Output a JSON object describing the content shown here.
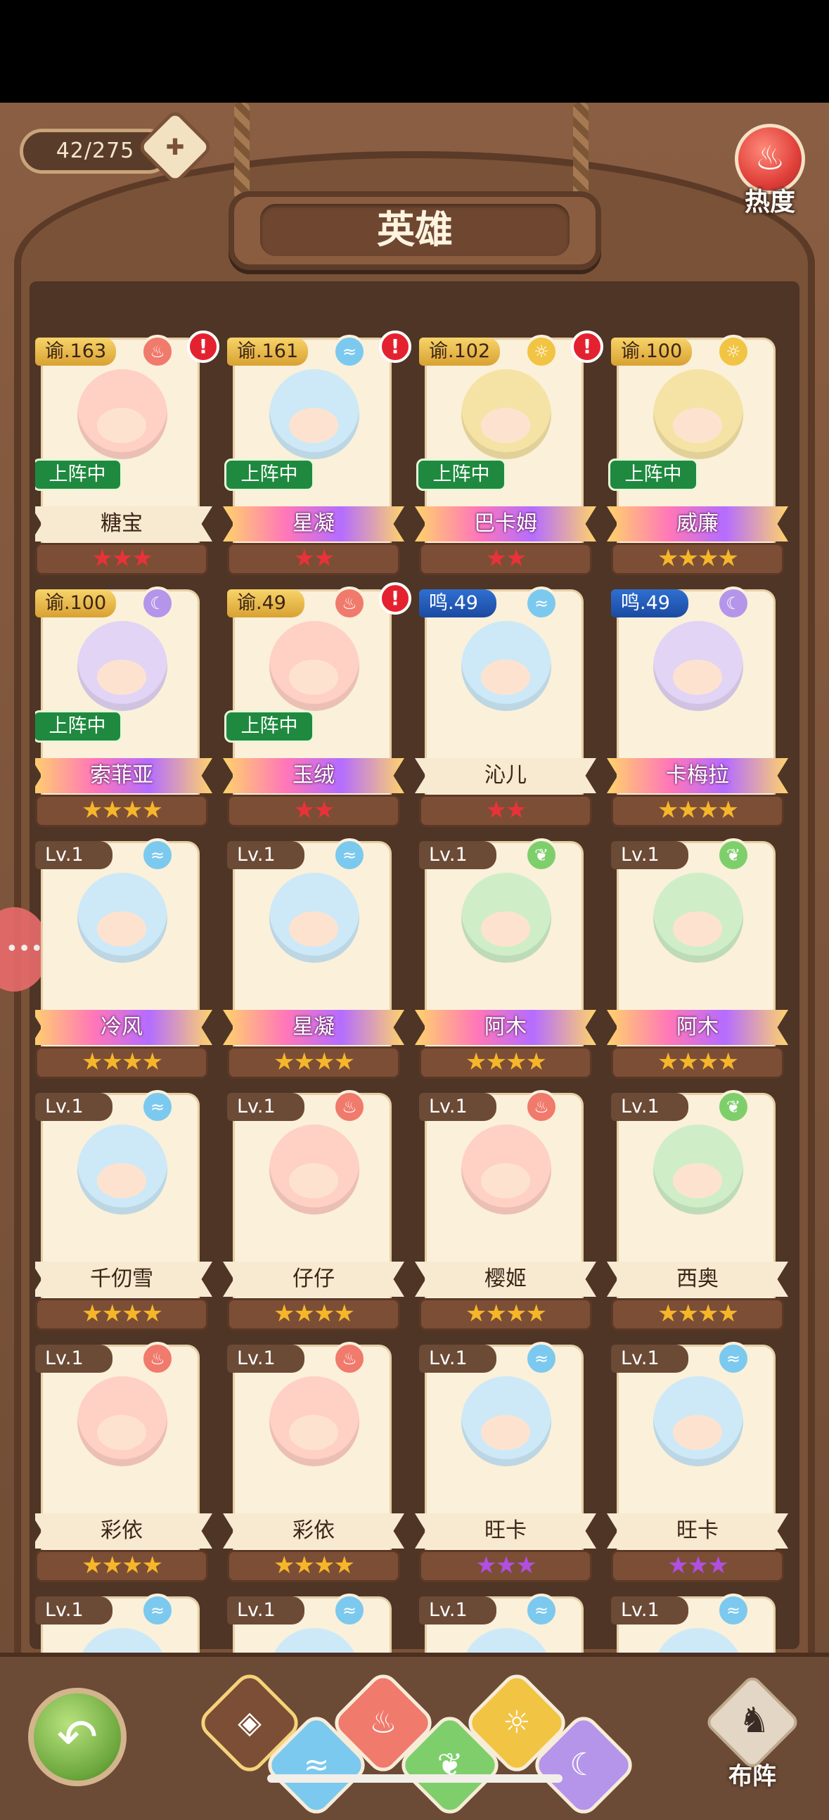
{
  "header": {
    "counter": "42/275",
    "title": "英雄",
    "heat_label": "热度"
  },
  "colors": {
    "fire": "#f07a6c",
    "water": "#7cc9ef",
    "light": "#f1c444",
    "dark": "#b595ea",
    "wood": "#7ecf6b"
  },
  "heroes": [
    {
      "level": "谕.163",
      "element": "fire",
      "name": "糖宝",
      "stars": "★★★",
      "alert": true,
      "on_team": "上阵中"
    },
    {
      "level": "谕.161",
      "element": "water",
      "name": "星凝",
      "stars": "★★",
      "alert": true,
      "on_team": "上阵中"
    },
    {
      "level": "谕.102",
      "element": "light",
      "name": "巴卡姆",
      "stars": "★★",
      "alert": true,
      "on_team": "上阵中"
    },
    {
      "level": "谕.100",
      "element": "light",
      "name": "威廉",
      "stars": "★★★★",
      "alert": false,
      "on_team": "上阵中"
    },
    {
      "level": "谕.100",
      "element": "dark",
      "name": "索菲亚",
      "stars": "★★★★",
      "alert": false,
      "on_team": "上阵中"
    },
    {
      "level": "谕.49",
      "element": "fire",
      "name": "玉绒",
      "stars": "★★",
      "alert": true,
      "on_team": "上阵中"
    },
    {
      "level": "鸣.49",
      "element": "water",
      "name": "沁儿",
      "stars": "★★",
      "alert": false,
      "on_team": ""
    },
    {
      "level": "鸣.49",
      "element": "dark",
      "name": "卡梅拉",
      "stars": "★★★★",
      "alert": false,
      "on_team": ""
    },
    {
      "level": "Lv.1",
      "element": "water",
      "name": "冷风",
      "stars": "★★★★",
      "alert": false,
      "on_team": ""
    },
    {
      "level": "Lv.1",
      "element": "water",
      "name": "星凝",
      "stars": "★★★★",
      "alert": false,
      "on_team": ""
    },
    {
      "level": "Lv.1",
      "element": "wood",
      "name": "阿木",
      "stars": "★★★★",
      "alert": false,
      "on_team": ""
    },
    {
      "level": "Lv.1",
      "element": "wood",
      "name": "阿木",
      "stars": "★★★★",
      "alert": false,
      "on_team": ""
    },
    {
      "level": "Lv.1",
      "element": "water",
      "name": "千仞雪",
      "stars": "★★★★",
      "alert": false,
      "on_team": ""
    },
    {
      "level": "Lv.1",
      "element": "fire",
      "name": "仔仔",
      "stars": "★★★★",
      "alert": false,
      "on_team": ""
    },
    {
      "level": "Lv.1",
      "element": "fire",
      "name": "樱姬",
      "stars": "★★★★",
      "alert": false,
      "on_team": ""
    },
    {
      "level": "Lv.1",
      "element": "wood",
      "name": "西奥",
      "stars": "★★★★",
      "alert": false,
      "on_team": ""
    },
    {
      "level": "Lv.1",
      "element": "fire",
      "name": "彩依",
      "stars": "★★★★",
      "alert": false,
      "on_team": ""
    },
    {
      "level": "Lv.1",
      "element": "fire",
      "name": "彩依",
      "stars": "★★★★",
      "alert": false,
      "on_team": ""
    },
    {
      "level": "Lv.1",
      "element": "water",
      "name": "旺卡",
      "stars": "★★★",
      "alert": false,
      "on_team": ""
    },
    {
      "level": "Lv.1",
      "element": "water",
      "name": "旺卡",
      "stars": "★★★",
      "alert": false,
      "on_team": ""
    },
    {
      "level": "Lv.1",
      "element": "water",
      "name": "",
      "stars": "",
      "alert": false,
      "on_team": ""
    },
    {
      "level": "Lv.1",
      "element": "water",
      "name": "",
      "stars": "",
      "alert": false,
      "on_team": ""
    },
    {
      "level": "Lv.1",
      "element": "water",
      "name": "",
      "stars": "",
      "alert": false,
      "on_team": ""
    },
    {
      "level": "Lv.1",
      "element": "water",
      "name": "",
      "stars": "",
      "alert": false,
      "on_team": ""
    }
  ],
  "filters": [
    {
      "icon": "all-icon",
      "glyph": "◈",
      "color": "#7c4e35"
    },
    {
      "icon": "water-icon",
      "glyph": "≈",
      "color": "#7cc9ef"
    },
    {
      "icon": "fire-icon",
      "glyph": "♨",
      "color": "#f07a6c"
    },
    {
      "icon": "wood-icon",
      "glyph": "❦",
      "color": "#7ecf6b"
    },
    {
      "icon": "light-icon",
      "glyph": "☼",
      "color": "#f1c444"
    },
    {
      "icon": "dark-icon",
      "glyph": "☾",
      "color": "#b595ea"
    }
  ],
  "footer": {
    "lineup_label": "布阵",
    "alert_mark": "!"
  }
}
